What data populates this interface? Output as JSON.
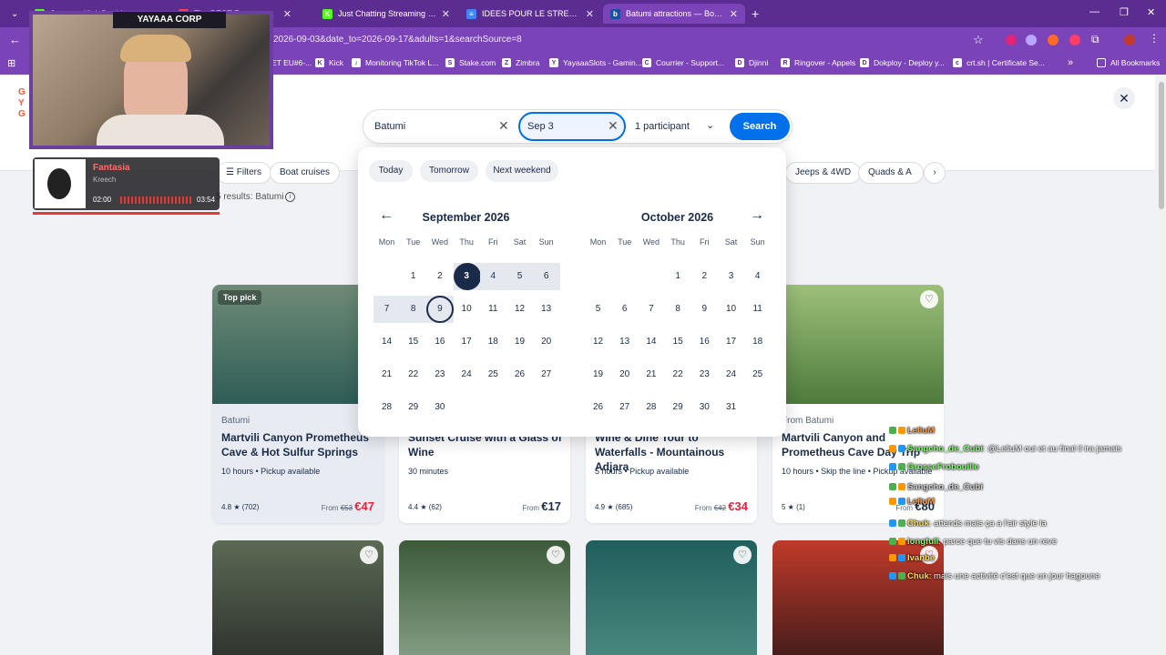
{
  "browser": {
    "tabs": [
      {
        "title": "Stream - Kick Dashboard",
        "fav": "K",
        "favcolor": "#53fc18"
      },
      {
        "title": "The BEST Zoom and The",
        "fav": "●",
        "favcolor": "#ff3d3d"
      },
      {
        "title": "Just Chatting Streaming - Live",
        "fav": "K",
        "favcolor": "#53fc18"
      },
      {
        "title": "IDEES POUR LE STREAM YAYA",
        "fav": "≡",
        "favcolor": "#4285f4"
      },
      {
        "title": "Batumi attractions — Booking.com",
        "fav": "b",
        "favcolor": "#1a4fa3"
      }
    ],
    "url": "2026-09-03&date_to=2026-09-17&adults=1&searchSource=8",
    "bookmarks": [
      {
        "label": "ET EU#6-...",
        "fav": ""
      },
      {
        "label": "Kick",
        "fav": "K"
      },
      {
        "label": "Monitoring TikTok L...",
        "fav": "♪"
      },
      {
        "label": "Stake.com",
        "fav": "S"
      },
      {
        "label": "Zimbra",
        "fav": "Z"
      },
      {
        "label": "YayaaaSlots - Gamin...",
        "fav": "Y"
      },
      {
        "label": "Courrier - Support...",
        "fav": "C"
      },
      {
        "label": "Djinni",
        "fav": "D"
      },
      {
        "label": "Ringover - Appels",
        "fav": "R"
      },
      {
        "label": "Dokploy - Deploy y...",
        "fav": "D"
      },
      {
        "label": "crt.sh | Certificate Se...",
        "fav": "c"
      }
    ],
    "all_bookmarks": "All Bookmarks"
  },
  "search": {
    "destination": "Batumi",
    "date": "Sep 3",
    "participants": "1 participant",
    "button": "Search"
  },
  "filters": {
    "chips": [
      "Filters",
      "Boat cruises",
      "Jeeps & 4WD",
      "Quads & A"
    ],
    "results": "5 results: Batumi"
  },
  "calendar": {
    "quick": [
      "Today",
      "Tomorrow",
      "Next weekend"
    ],
    "weekdays": [
      "Mon",
      "Tue",
      "Wed",
      "Thu",
      "Fri",
      "Sat",
      "Sun"
    ],
    "months": [
      {
        "title": "September 2026",
        "offset": 1,
        "days": 30
      },
      {
        "title": "October 2026",
        "offset": 3,
        "days": 31
      }
    ],
    "selected_day": 3,
    "hover_day": 9
  },
  "cards": [
    {
      "badge": "Top pick",
      "loc": "Batumi",
      "title": "Martvili Canyon Prometheus Cave & Hot Sulfur Springs",
      "meta": "10 hours • Pickup available",
      "rating": "4.8 ★ (702)",
      "from": "From",
      "old": "€53",
      "price": "€47",
      "color1": "#2e5d57",
      "color2": "#6f8b77"
    },
    {
      "badge": "",
      "loc": "",
      "title": "Sunset Cruise with a Glass of Wine",
      "meta": "30 minutes",
      "rating": "4.4 ★ (62)",
      "from": "From",
      "old": "",
      "price": "€17",
      "color1": "#8a5a3a",
      "color2": "#d0a070"
    },
    {
      "badge": "",
      "loc": "",
      "title": "Wine & Dine Tour to Waterfalls - Mountainous Adjara",
      "meta": "5 hours • Pickup available",
      "rating": "4.9 ★ (685)",
      "from": "From",
      "old": "€42",
      "price": "€34",
      "color1": "#3f6b4a",
      "color2": "#8fb08a"
    },
    {
      "badge": "",
      "loc": "From Batumi",
      "title": "Martvili Canyon and Prometheus Cave Day Trip",
      "meta": "10 hours • Skip the line • Pickup available",
      "rating": "5 ★ (1)",
      "from": "From",
      "old": "",
      "price": "€80",
      "color1": "#4e7a3c",
      "color2": "#9cc07a"
    }
  ],
  "spotify": {
    "title": "Fantasia",
    "artist": "Kreech",
    "time_now": "02:00",
    "time_total": "03:54"
  },
  "webcam": {
    "banner": "YAYAAA CORP"
  },
  "chat": [
    {
      "user": "LeliuM",
      "color": "#ff9a3d",
      "msg": ""
    },
    {
      "user": "Sangcho_de_Cubi",
      "color": "#7cff6b",
      "msg": ": @LeliuM oui et au final il ira jamais"
    },
    {
      "user": "GrosseFrobouille",
      "color": "#7cff6b",
      "msg": ""
    },
    {
      "user": "Sangcho_de_Cubi",
      "color": "#cfcfcf",
      "msg": ""
    },
    {
      "user": "LeliuM",
      "color": "#ff9a3d",
      "msg": ""
    },
    {
      "user": "Chuk",
      "color": "#ffde3d",
      "msg": ": attends mais ça a l'air style la"
    },
    {
      "user": "longfull",
      "color": "#7cff6b",
      "msg": ": parce que tu vis dans un reve"
    },
    {
      "user": "Ivanbe",
      "color": "#ffde3d",
      "msg": ""
    },
    {
      "user": "Chuk",
      "color": "#ffde3d",
      "msg": ": mais une activité c'est que un jour hagoune"
    }
  ]
}
